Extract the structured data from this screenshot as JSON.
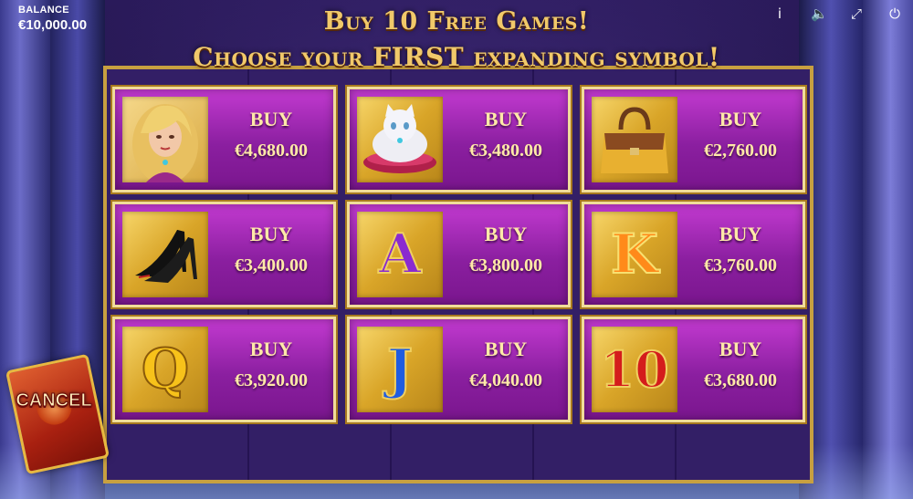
{
  "balance": {
    "label": "BALANCE",
    "value": "€10,000.00"
  },
  "controls": [
    {
      "name": "info-icon",
      "glyph": "i"
    },
    {
      "name": "sound-icon",
      "glyph": "🔈"
    },
    {
      "name": "fullscreen-icon",
      "glyph": "⤢"
    },
    {
      "name": "power-icon",
      "glyph": "⏻"
    }
  ],
  "title": {
    "line1": "Buy 10 Free Games!",
    "line2": "Choose your FIRST expanding symbol!"
  },
  "tiles": [
    {
      "symbol": "lady",
      "buy_label": "BUY",
      "price": "€4,680.00"
    },
    {
      "symbol": "cat",
      "buy_label": "BUY",
      "price": "€3,480.00"
    },
    {
      "symbol": "handbag",
      "buy_label": "BUY",
      "price": "€2,760.00"
    },
    {
      "symbol": "shoes",
      "buy_label": "BUY",
      "price": "€3,400.00"
    },
    {
      "symbol": "A",
      "buy_label": "BUY",
      "price": "€3,800.00"
    },
    {
      "symbol": "K",
      "buy_label": "BUY",
      "price": "€3,760.00"
    },
    {
      "symbol": "Q",
      "buy_label": "BUY",
      "price": "€3,920.00"
    },
    {
      "symbol": "J",
      "buy_label": "BUY",
      "price": "€4,040.00"
    },
    {
      "symbol": "10",
      "buy_label": "BUY",
      "price": "€3,680.00"
    }
  ],
  "cancel": {
    "label": "CANCEL"
  }
}
